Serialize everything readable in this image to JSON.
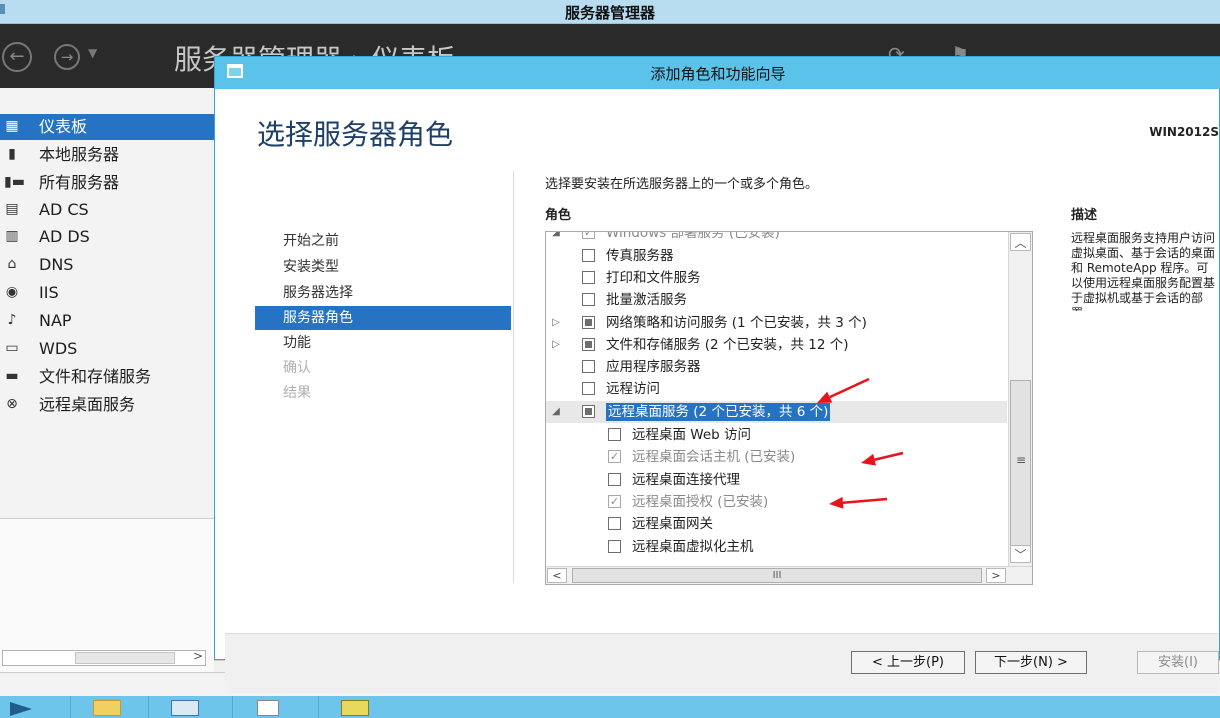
{
  "outer_window": {
    "title": "服务器管理器"
  },
  "server_manager": {
    "breadcrumb": "服务器管理器 › 仪表板",
    "nav_items": [
      {
        "label": "仪表板",
        "icon": "dashboard-icon",
        "glyph": "▦",
        "active": true
      },
      {
        "label": "本地服务器",
        "icon": "server-icon",
        "glyph": "▮",
        "active": false
      },
      {
        "label": "所有服务器",
        "icon": "servers-icon",
        "glyph": "▮▬",
        "active": false
      },
      {
        "label": "AD CS",
        "icon": "ad-cs-icon",
        "glyph": "▤",
        "active": false
      },
      {
        "label": "AD DS",
        "icon": "ad-ds-icon",
        "glyph": "▥",
        "active": false
      },
      {
        "label": "DNS",
        "icon": "dns-icon",
        "glyph": "⌂",
        "active": false
      },
      {
        "label": "IIS",
        "icon": "iis-icon",
        "glyph": "◉",
        "active": false
      },
      {
        "label": "NAP",
        "icon": "nap-icon",
        "glyph": "♪",
        "active": false
      },
      {
        "label": "WDS",
        "icon": "wds-icon",
        "glyph": "▭",
        "active": false
      },
      {
        "label": "文件和存储服务",
        "icon": "file-storage-icon",
        "glyph": "▬",
        "active": false
      },
      {
        "label": "远程桌面服务",
        "icon": "remote-desktop-icon",
        "glyph": "⊗",
        "active": false
      }
    ]
  },
  "dialog": {
    "title": "添加角色和功能向导",
    "heading": "选择服务器角色",
    "target_server": "WIN2012S",
    "steps": [
      {
        "label": "开始之前",
        "state": "normal"
      },
      {
        "label": "安装类型",
        "state": "normal"
      },
      {
        "label": "服务器选择",
        "state": "normal"
      },
      {
        "label": "服务器角色",
        "state": "active"
      },
      {
        "label": "功能",
        "state": "normal"
      },
      {
        "label": "确认",
        "state": "disabled"
      },
      {
        "label": "结果",
        "state": "disabled"
      }
    ],
    "instruction": "选择要安装在所选服务器上的一个或多个角色。",
    "roles_header": "角色",
    "description_header": "描述",
    "description_text": "远程桌面服务支持用户访问虚拟桌面、基于会话的桌面和 RemoteApp 程序。可以使用远程桌面服务配置基于虚拟机或基于会话的部署。",
    "roles": [
      {
        "label": "Windows 部署服务 (已安装)",
        "check": "checked-disabled",
        "expander": "expanded",
        "indent": 0,
        "clipped": true
      },
      {
        "label": "传真服务器",
        "check": "unchecked",
        "expander": "",
        "indent": 0
      },
      {
        "label": "打印和文件服务",
        "check": "unchecked",
        "expander": "",
        "indent": 0
      },
      {
        "label": "批量激活服务",
        "check": "unchecked",
        "expander": "",
        "indent": 0
      },
      {
        "label": "网络策略和访问服务 (1 个已安装，共 3 个)",
        "check": "partial",
        "expander": "collapsed",
        "indent": 0
      },
      {
        "label": "文件和存储服务 (2 个已安装，共 12 个)",
        "check": "partial",
        "expander": "collapsed",
        "indent": 0
      },
      {
        "label": "应用程序服务器",
        "check": "unchecked",
        "expander": "",
        "indent": 0
      },
      {
        "label": "远程访问",
        "check": "unchecked",
        "expander": "",
        "indent": 0
      },
      {
        "label": "远程桌面服务 (2 个已安装，共 6 个)",
        "check": "partial",
        "expander": "expanded",
        "indent": 0,
        "selected": true
      },
      {
        "label": "远程桌面 Web 访问",
        "check": "unchecked",
        "expander": "",
        "indent": 1
      },
      {
        "label": "远程桌面会话主机 (已安装)",
        "check": "checked-disabled",
        "expander": "",
        "indent": 1
      },
      {
        "label": "远程桌面连接代理",
        "check": "unchecked",
        "expander": "",
        "indent": 1
      },
      {
        "label": "远程桌面授权 (已安装)",
        "check": "checked-disabled",
        "expander": "",
        "indent": 1
      },
      {
        "label": "远程桌面网关",
        "check": "unchecked",
        "expander": "",
        "indent": 1
      },
      {
        "label": "远程桌面虚拟化主机",
        "check": "unchecked",
        "expander": "",
        "indent": 1
      }
    ],
    "scroll": {
      "up": "︿",
      "down": "﹀",
      "left": "<",
      "right": ">",
      "grip": "≡",
      "hgrip": "III"
    },
    "buttons": {
      "prev": "< 上一步(P)",
      "next": "下一步(N) >",
      "install": "安装(I)"
    }
  },
  "annotation_color": "#e8141c",
  "taskbar": {
    "items": [
      "powershell-icon",
      "file-explorer-icon",
      "server-manager-icon",
      "notepad-icon",
      "tools-icon"
    ]
  }
}
